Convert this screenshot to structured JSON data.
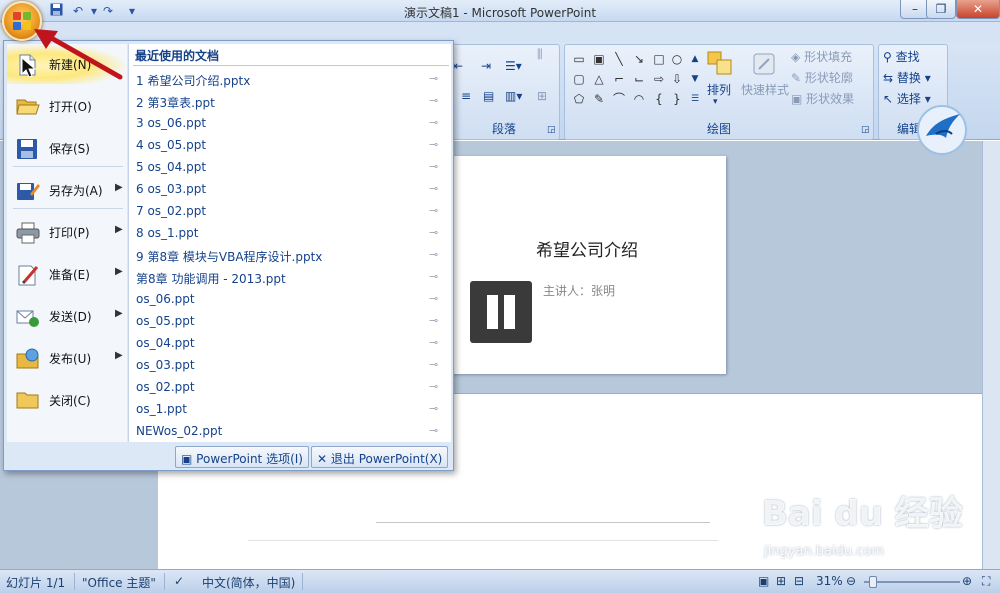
{
  "window": {
    "title": "演示文稿1 - Microsoft PowerPoint",
    "minimize_icon": "minimize-icon",
    "maximize_icon": "restore-icon",
    "close_icon": "close-icon"
  },
  "quick_access": {
    "save_icon": "save-icon",
    "undo_icon": "undo-icon",
    "redo_icon": "redo-icon",
    "customize_icon": "chevron-down-icon"
  },
  "ribbon": {
    "groups": {
      "paragraph": "段落",
      "drawing": "绘图",
      "editing": "编辑"
    },
    "drawing_buttons": {
      "arrange": "排列",
      "quick_styles": "快速样式",
      "shape_fill": "形状填充",
      "shape_outline": "形状轮廓",
      "shape_effects": "形状效果"
    },
    "editing_buttons": {
      "find": "查找",
      "replace": "替换",
      "select": "选择"
    }
  },
  "office_menu": {
    "items": [
      {
        "label": "新建(N)",
        "icon": "new-document-icon",
        "has_submenu": false
      },
      {
        "label": "打开(O)",
        "icon": "open-folder-icon",
        "has_submenu": false
      },
      {
        "label": "保存(S)",
        "icon": "save-disk-icon",
        "has_submenu": false
      },
      {
        "label": "另存为(A)",
        "icon": "save-as-icon",
        "has_submenu": true
      },
      {
        "label": "打印(P)",
        "icon": "printer-icon",
        "has_submenu": true
      },
      {
        "label": "准备(E)",
        "icon": "prepare-icon",
        "has_submenu": true
      },
      {
        "label": "发送(D)",
        "icon": "send-icon",
        "has_submenu": true
      },
      {
        "label": "发布(U)",
        "icon": "publish-icon",
        "has_submenu": true
      },
      {
        "label": "关闭(C)",
        "icon": "close-folder-icon",
        "has_submenu": false
      }
    ],
    "recent_header": "最近使用的文档",
    "recent_documents": [
      "1 希望公司介绍.pptx",
      "2 第3章表.ppt",
      "3 os_06.ppt",
      "4 os_05.ppt",
      "5 os_04.ppt",
      "6 os_03.ppt",
      "7 os_02.ppt",
      "8 os_1.ppt",
      "9 第8章 模块与VBA程序设计.pptx",
      "第8章 功能调用 - 2013.ppt",
      "os_06.ppt",
      "os_05.ppt",
      "os_04.ppt",
      "os_03.ppt",
      "os_02.ppt",
      "os_1.ppt",
      "NEWos_02.ppt"
    ],
    "pin_icon": "pin-icon",
    "options_button": "PowerPoint 选项(I)",
    "exit_button": "退出 PowerPoint(X)"
  },
  "slide": {
    "title": "希望公司介绍",
    "subtitle": "主讲人：张明"
  },
  "video_overlay": {
    "icon": "pause-icon"
  },
  "status_bar": {
    "slide_counter": "幻灯片 1/1",
    "theme": "\"Office 主题\"",
    "language": "中文(简体，中国)",
    "zoom": "31%",
    "zoom_level": 0.31
  },
  "watermark": {
    "brand": "Bai du 经验",
    "url": "jingyan.baidu.com"
  },
  "colors": {
    "ribbon_blue": "#c4d7ef",
    "menu_text": "#15428b",
    "annotation_red": "#c0141c",
    "office_orange": "#e9951d"
  }
}
